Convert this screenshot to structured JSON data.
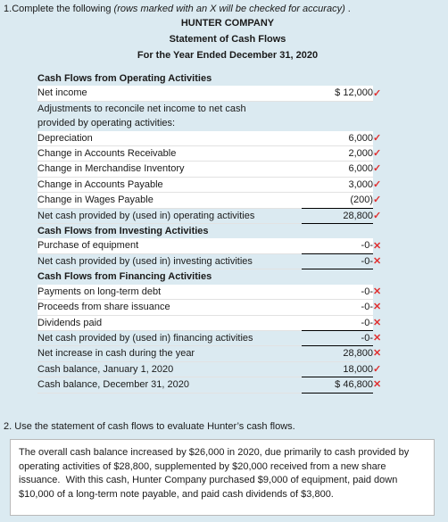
{
  "page": {
    "background_color": "#dbeaf1",
    "mark_color": "#e03030"
  },
  "question1": {
    "number": "1.",
    "text": "Complete the following ",
    "italic_note": "(rows marked with an X will be checked for accuracy)",
    "trailing": " ."
  },
  "statement": {
    "company": "HUNTER COMPANY",
    "title": "Statement of Cash Flows",
    "period": "For the Year Ended December 31, 2020",
    "rows": [
      {
        "label": "Cash Flows from Operating Activities",
        "value": "",
        "mark": "",
        "type": "section",
        "indent": 0
      },
      {
        "label": "Net income",
        "value": "$ 12,000",
        "mark": "check",
        "type": "item",
        "indent": 1
      },
      {
        "label": "Adjustments to reconcile net income to net cash",
        "value": "",
        "mark": "",
        "type": "note",
        "indent": 1
      },
      {
        "label": "provided by operating activities:",
        "value": "",
        "mark": "",
        "type": "note",
        "indent": 1
      },
      {
        "label": "Depreciation",
        "value": "6,000",
        "mark": "check",
        "type": "item",
        "indent": 1
      },
      {
        "label": "Change in Accounts Receivable",
        "value": "2,000",
        "mark": "check",
        "type": "item",
        "indent": 1
      },
      {
        "label": "Change in Merchandise Inventory",
        "value": "6,000",
        "mark": "check",
        "type": "item",
        "indent": 1
      },
      {
        "label": "Change in Accounts Payable",
        "value": "3,000",
        "mark": "check",
        "type": "item",
        "indent": 1
      },
      {
        "label": "Change in Wages Payable",
        "value": "(200)",
        "mark": "check",
        "type": "item",
        "indent": 1,
        "rule": "bottom"
      },
      {
        "label": "Net cash provided by (used in) operating activities",
        "value": "28,800",
        "mark": "check",
        "type": "subtotal",
        "indent": 2,
        "rule": "bottom"
      },
      {
        "label": "Cash Flows from Investing Activities",
        "value": "",
        "mark": "",
        "type": "section",
        "indent": 0
      },
      {
        "label": "Purchase of equipment",
        "value": "-0-",
        "mark": "x",
        "type": "item",
        "indent": 1,
        "rule": "bottom"
      },
      {
        "label": "Net cash provided by (used in) investing activities",
        "value": "-0-",
        "mark": "x",
        "type": "subtotal",
        "indent": 2,
        "rule": "bottom"
      },
      {
        "label": "Cash Flows from Financing Activities",
        "value": "",
        "mark": "",
        "type": "section",
        "indent": 0
      },
      {
        "label": "Payments on long-term debt",
        "value": "-0-",
        "mark": "x",
        "type": "item",
        "indent": 1
      },
      {
        "label": "Proceeds from share issuance",
        "value": "-0-",
        "mark": "x",
        "type": "item",
        "indent": 1
      },
      {
        "label": "Dividends paid",
        "value": "-0-",
        "mark": "x",
        "type": "item",
        "indent": 1,
        "rule": "bottom"
      },
      {
        "label": "Net cash provided by (used in) financing activities",
        "value": "-0-",
        "mark": "x",
        "type": "subtotal",
        "indent": 2,
        "rule": "bottom"
      },
      {
        "label": "Net increase in cash during the year",
        "value": "28,800",
        "mark": "x",
        "type": "plain",
        "indent": 0
      },
      {
        "label": "Cash balance, January 1, 2020",
        "value": "18,000",
        "mark": "check",
        "type": "plain",
        "indent": 0,
        "rule": "bottom"
      },
      {
        "label": "Cash balance, December 31, 2020",
        "value": "$ 46,800",
        "mark": "x",
        "type": "plain",
        "indent": 0,
        "rule": "bottom"
      }
    ],
    "mark_glyphs": {
      "check": "✓",
      "x": "✕"
    }
  },
  "question2": {
    "number": "2.",
    "text": "Use the statement of cash flows to evaluate Hunter’s cash flows.",
    "answer": "The overall cash balance increased by $26,000 in 2020, due primarily to cash provided by operating activities of $28,800, supplemented by $20,000 received from a new share issuance.  With this cash, Hunter Company purchased $9,000 of equipment, paid down $10,000 of a long-term note payable, and paid cash dividends of $3,800."
  }
}
